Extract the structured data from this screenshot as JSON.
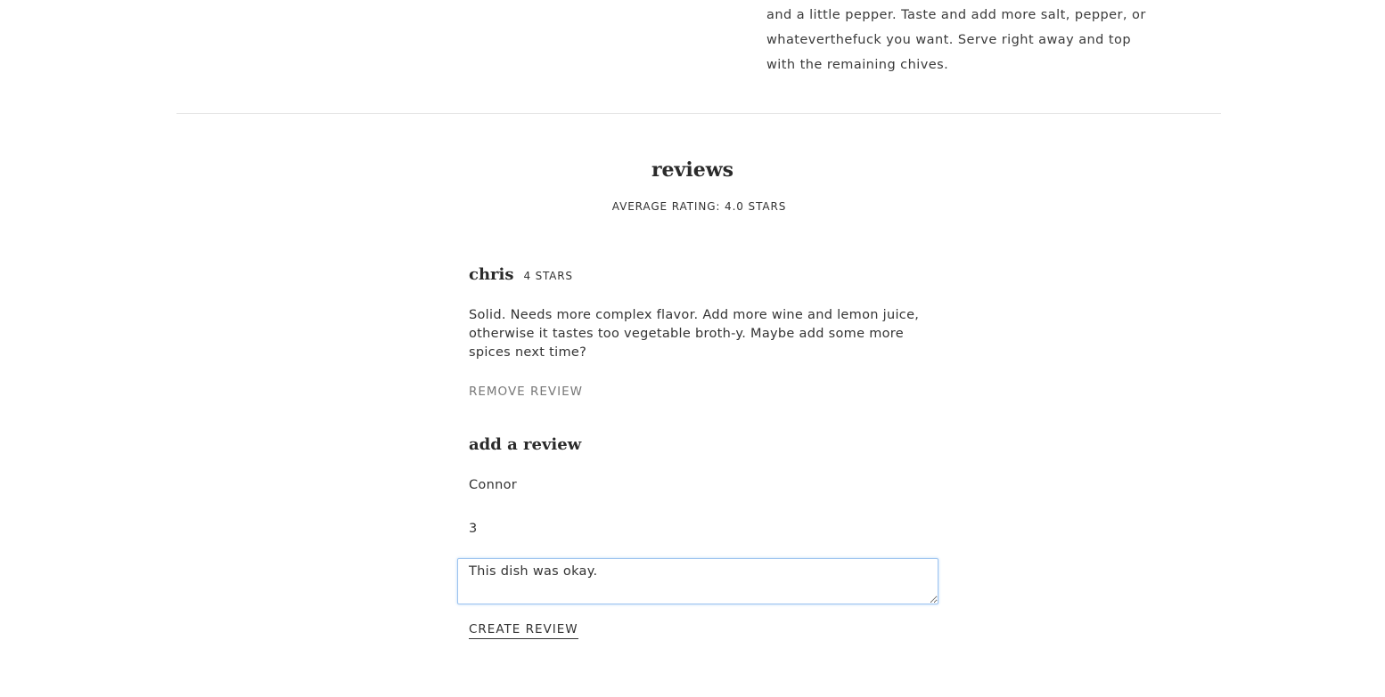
{
  "recipe": {
    "instructions_tail": "and a little pepper. Taste and add more salt, pepper, or whateverthefuck you want. Serve right away and top with the remaining chives."
  },
  "reviews": {
    "heading": "reviews",
    "average_rating": "AVERAGE RATING: 4.0 STARS",
    "items": [
      {
        "author": "chris",
        "stars": "4 STARS",
        "body": "Solid. Needs more complex flavor. Add more wine and lemon juice, otherwise it tastes too vegetable broth-y. Maybe add some more spices next time?",
        "remove_label": "REMOVE REVIEW"
      }
    ]
  },
  "add_review": {
    "heading": "add a review",
    "name_value": "Connor",
    "rating_value": "3",
    "body_value": "This dish was okay.",
    "submit_label": "CREATE REVIEW"
  }
}
